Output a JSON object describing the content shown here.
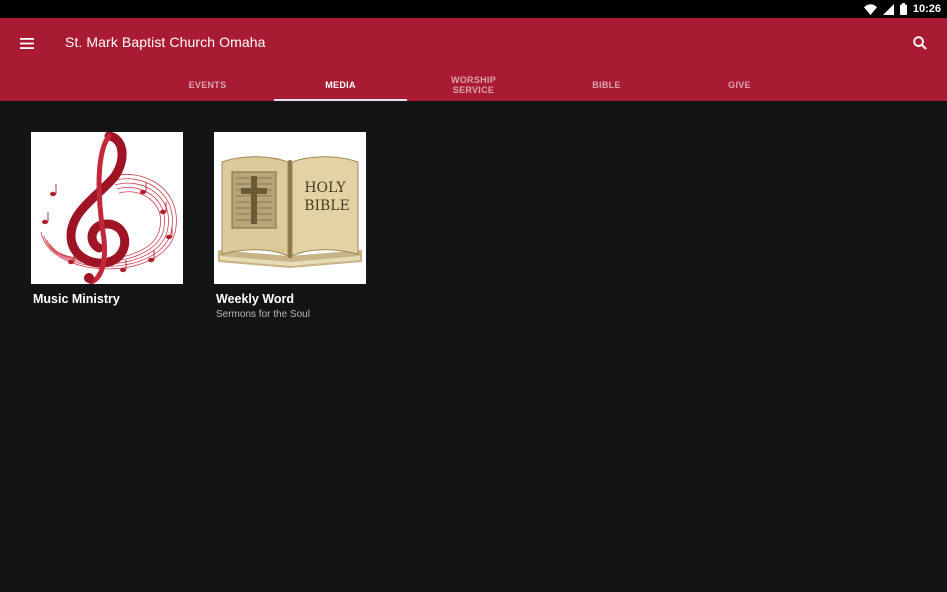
{
  "status_bar": {
    "time": "10:26",
    "icons": [
      "wifi-icon",
      "signal-icon",
      "battery-icon"
    ]
  },
  "appbar": {
    "title": "St. Mark Baptist Church Omaha",
    "menu_icon": "hamburger-menu-icon",
    "search_icon": "search-icon",
    "background": "#a91a33"
  },
  "tabs": [
    {
      "label": "EVENTS",
      "active": false
    },
    {
      "label": "MEDIA",
      "active": true
    },
    {
      "label": "WORSHIP\nSERVICE",
      "active": false
    },
    {
      "label": "BIBLE",
      "active": false
    },
    {
      "label": "GIVE",
      "active": false
    }
  ],
  "media_items": [
    {
      "title": "Music Ministry",
      "subtitle": "",
      "image": "treble-clef-music-notes"
    },
    {
      "title": "Weekly Word",
      "subtitle": "Sermons for the Soul",
      "image": "open-holy-bible"
    }
  ],
  "bible_cover_text": {
    "line1": "HOLY",
    "line2": "BIBLE"
  }
}
